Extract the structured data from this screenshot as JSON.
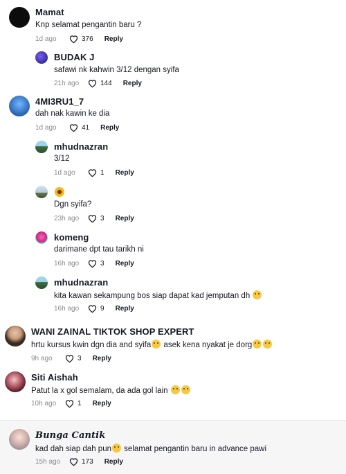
{
  "comments": [
    {
      "username": "Mamat",
      "text": "Knp selamat pengantin baru ?",
      "time": "1d ago",
      "likes": "376",
      "reply": "Reply"
    },
    {
      "username": "BUDAK J",
      "text": "safawi nk kahwin 3/12 dengan syifa",
      "time": "21h ago",
      "likes": "144",
      "reply": "Reply"
    },
    {
      "username": "4MI3RU1_7",
      "text": "dah nak kawin ke dia",
      "time": "1d ago",
      "likes": "41",
      "reply": "Reply"
    },
    {
      "username": "mhudnazran",
      "text": "3/12",
      "time": "1d ago",
      "likes": "1",
      "reply": "Reply"
    },
    {
      "username": "",
      "text": "Dgn syifa?",
      "time": "23h ago",
      "likes": "3",
      "reply": "Reply"
    },
    {
      "username": "komeng",
      "text": "darimane dpt tau tarikh ni",
      "time": "16h ago",
      "likes": "3",
      "reply": "Reply"
    },
    {
      "username": "mhudnazran",
      "text": "kita kawan sekampung bos siap dapat kad jemputan dh",
      "time": "16h ago",
      "likes": "9",
      "reply": "Reply"
    },
    {
      "username": "WANI ZAINAL TIKTOK SHOP EXPERT",
      "text": "hrtu kursus kwin dgn dia and syifa",
      "text2": " asek kena nyakat je dorg",
      "time": "9h ago",
      "likes": "3",
      "reply": "Reply"
    },
    {
      "username": "Siti Aishah",
      "text": "Patut la x gol semalam, da ada gol lain ",
      "time": "10h ago",
      "likes": "1",
      "reply": "Reply"
    },
    {
      "username": "Bunga Cantik",
      "text": "kad dah siap dah pun",
      "text2": " selamat pengantin baru in advance pawi",
      "time": "15h ago",
      "likes": "173",
      "reply": "Reply"
    }
  ],
  "icons": {
    "like": "heart-outline-icon"
  },
  "colors": {
    "meta": "#8a8b91",
    "text": "#161823",
    "sticky_bg": "#f6f6f7"
  }
}
